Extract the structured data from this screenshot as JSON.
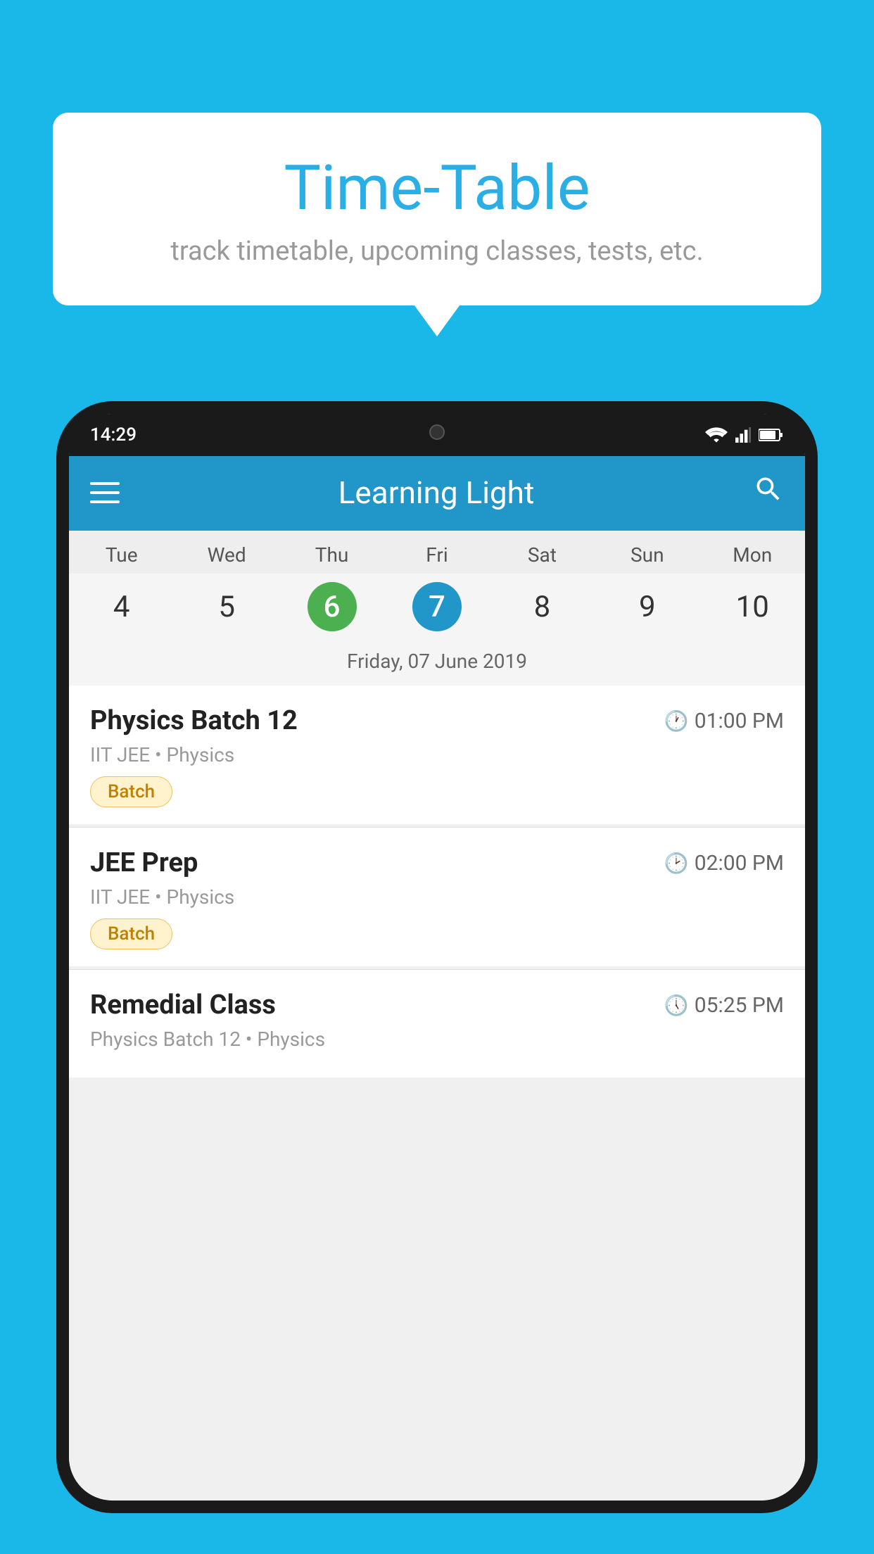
{
  "background_color": "#1ab8e8",
  "speech_bubble": {
    "title": "Time-Table",
    "subtitle": "track timetable, upcoming classes, tests, etc."
  },
  "phone": {
    "status_bar": {
      "time": "14:29",
      "icons": [
        "wifi",
        "signal",
        "battery"
      ]
    },
    "app_bar": {
      "title": "Learning Light",
      "menu_icon": "hamburger-icon",
      "search_icon": "search-icon"
    },
    "calendar": {
      "day_names": [
        "Tue",
        "Wed",
        "Thu",
        "Fri",
        "Sat",
        "Sun",
        "Mon"
      ],
      "day_numbers": [
        "4",
        "5",
        "6",
        "7",
        "8",
        "9",
        "10"
      ],
      "today_index": 2,
      "selected_index": 3,
      "selected_date_label": "Friday, 07 June 2019"
    },
    "schedule_items": [
      {
        "title": "Physics Batch 12",
        "time": "01:00 PM",
        "subtitle": "IIT JEE • Physics",
        "badge": "Batch"
      },
      {
        "title": "JEE Prep",
        "time": "02:00 PM",
        "subtitle": "IIT JEE • Physics",
        "badge": "Batch"
      },
      {
        "title": "Remedial Class",
        "time": "05:25 PM",
        "subtitle": "Physics Batch 12 • Physics",
        "badge": null
      }
    ]
  }
}
